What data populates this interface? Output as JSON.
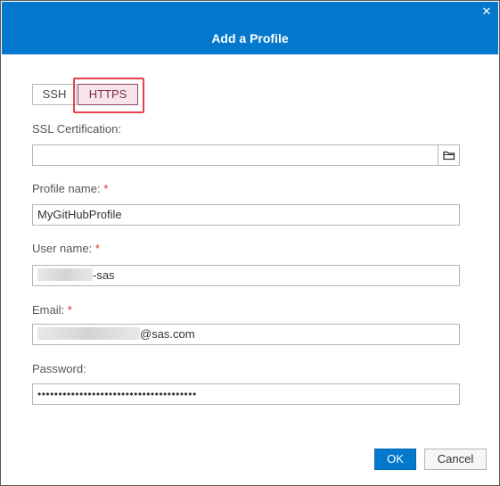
{
  "dialog": {
    "title": "Add a Profile",
    "close_icon": "close-icon",
    "accent_color": "#0378cd"
  },
  "protocol": {
    "options": [
      "SSH",
      "HTTPS"
    ],
    "selected": "HTTPS"
  },
  "fields": {
    "ssl_certification": {
      "label": "SSL Certification:",
      "value": "",
      "required": false,
      "browse_icon": "folder-icon"
    },
    "profile_name": {
      "label": "Profile name:",
      "value": "MyGitHubProfile",
      "required": true
    },
    "user_name": {
      "label": "User name:",
      "value_suffix": "-sas",
      "required": true
    },
    "email": {
      "label": "Email:",
      "value_suffix": "@sas.com",
      "required": true
    },
    "password": {
      "label": "Password:",
      "value": "••••••••••••••••••••••••••••••••••••••",
      "required": false
    }
  },
  "required_marker": "*",
  "buttons": {
    "ok": "OK",
    "cancel": "Cancel"
  }
}
